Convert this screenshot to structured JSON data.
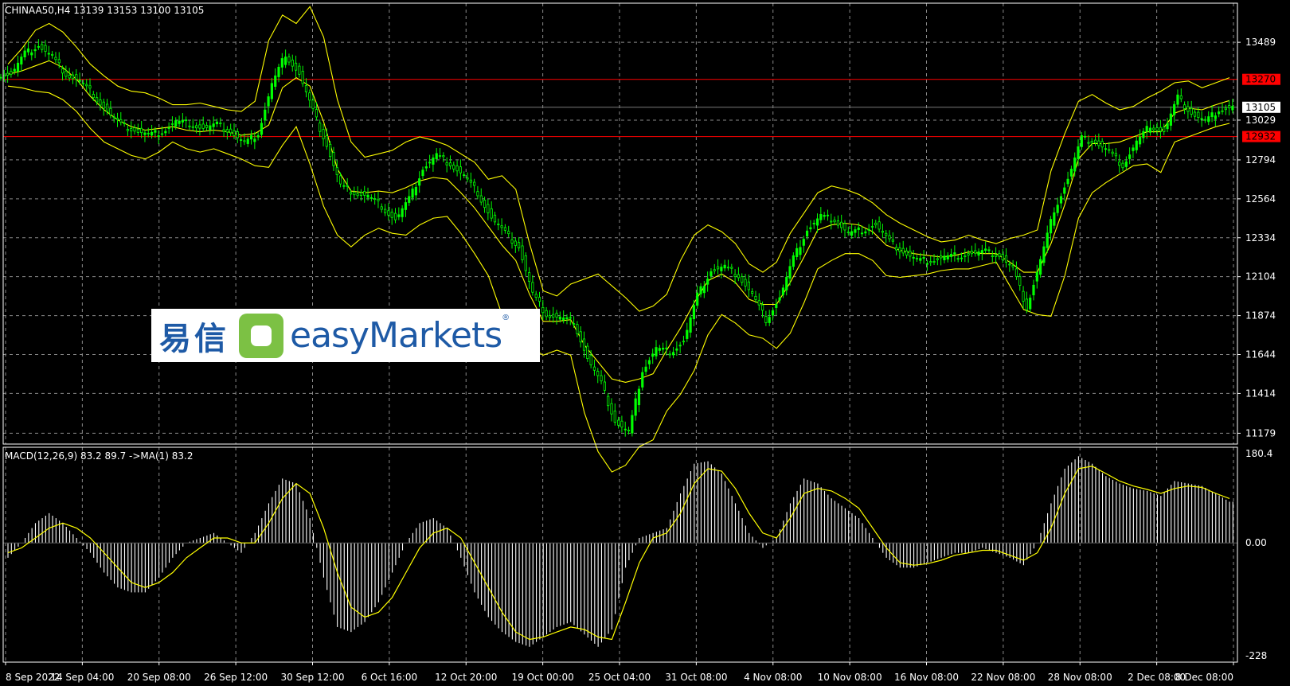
{
  "header": {
    "symbol_line": "CHINAA50,H4  13139 13153 13100 13105",
    "macd_line": "MACD(12,26,9) 83.2 89.7  ->MA(1) 83.2"
  },
  "logo": {
    "chinese": "易信",
    "english": "easyMarkets",
    "reg": "®"
  },
  "colors": {
    "background": "#000000",
    "grid": "#8a8a8a",
    "candle": "#00ff00",
    "bands": "#ffff00",
    "hline": "#ff0000",
    "text": "#ffffff",
    "macd_hist": "#ffffff",
    "macd_signal": "#ffff00"
  },
  "chart_data": [
    {
      "type": "line",
      "name": "price",
      "y_ticks": [
        13489,
        13029,
        12794,
        12564,
        12334,
        12104,
        11874,
        11644,
        11414,
        11179
      ],
      "ylim": [
        11115,
        13720
      ],
      "horizontal_levels": [
        13270,
        12932
      ],
      "current_price": 13105,
      "x_ticks": [
        "8 Sep 2022",
        "14 Sep 04:00",
        "20 Sep 08:00",
        "26 Sep 12:00",
        "30 Sep 12:00",
        "6 Oct 16:00",
        "12 Oct 20:00",
        "19 Oct 00:00",
        "25 Oct 04:00",
        "31 Oct 08:00",
        "4 Nov 08:00",
        "10 Nov 08:00",
        "16 Nov 08:00",
        "22 Nov 08:00",
        "28 Nov 08:00",
        "2 Dec 08:00",
        "8 Dec 08:00"
      ],
      "close": [
        13300,
        13420,
        13470,
        13400,
        13300,
        13260,
        13180,
        13080,
        13000,
        12970,
        12940,
        12960,
        13020,
        13010,
        12980,
        13000,
        12960,
        12890,
        12950,
        13240,
        13420,
        13300,
        13080,
        12880,
        12640,
        12600,
        12580,
        12520,
        12440,
        12560,
        12740,
        12820,
        12770,
        12700,
        12600,
        12450,
        12360,
        12280,
        12000,
        11880,
        11860,
        11840,
        11620,
        11470,
        11250,
        11180,
        11550,
        11680,
        11660,
        11720,
        11990,
        12140,
        12160,
        12110,
        12000,
        11850,
        11980,
        12210,
        12380,
        12460,
        12440,
        12360,
        12380,
        12410,
        12310,
        12250,
        12200,
        12200,
        12220,
        12230,
        12240,
        12250,
        12230,
        12150,
        11920,
        12200,
        12500,
        12680,
        12920,
        12900,
        12840,
        12760,
        12900,
        13000,
        12960,
        13160,
        13070,
        13020,
        13090,
        13105
      ],
      "upper_band": [
        13360,
        13450,
        13560,
        13600,
        13550,
        13460,
        13360,
        13290,
        13230,
        13200,
        13190,
        13160,
        13120,
        13120,
        13130,
        13110,
        13090,
        13080,
        13140,
        13500,
        13650,
        13600,
        13700,
        13520,
        13150,
        12900,
        12810,
        12830,
        12850,
        12900,
        12930,
        12910,
        12880,
        12830,
        12780,
        12680,
        12700,
        12620,
        12300,
        12020,
        11990,
        12060,
        12090,
        12120,
        12050,
        11980,
        11900,
        11930,
        12000,
        12200,
        12350,
        12410,
        12370,
        12300,
        12180,
        12130,
        12190,
        12360,
        12480,
        12600,
        12640,
        12620,
        12590,
        12540,
        12470,
        12420,
        12380,
        12340,
        12310,
        12320,
        12350,
        12320,
        12300,
        12330,
        12350,
        12380,
        12730,
        12950,
        13140,
        13180,
        13130,
        13090,
        13110,
        13160,
        13200,
        13250,
        13260,
        13220,
        13250,
        13280
      ],
      "lower_band": [
        13230,
        13220,
        13200,
        13190,
        13150,
        13080,
        12980,
        12900,
        12860,
        12820,
        12800,
        12840,
        12900,
        12860,
        12840,
        12860,
        12830,
        12800,
        12760,
        12750,
        12880,
        12990,
        12770,
        12520,
        12350,
        12280,
        12350,
        12390,
        12360,
        12350,
        12410,
        12450,
        12460,
        12360,
        12240,
        12110,
        11880,
        11790,
        11690,
        11640,
        11670,
        11640,
        11300,
        11070,
        10950,
        10990,
        11100,
        11140,
        11310,
        11410,
        11550,
        11760,
        11880,
        11830,
        11760,
        11740,
        11680,
        11770,
        11950,
        12150,
        12200,
        12240,
        12240,
        12200,
        12110,
        12100,
        12110,
        12120,
        12140,
        12150,
        12150,
        12170,
        12190,
        12050,
        11910,
        11880,
        11870,
        12110,
        12450,
        12600,
        12660,
        12710,
        12760,
        12770,
        12720,
        12900,
        12930,
        12960,
        12990,
        13010
      ],
      "middle_band": [
        13300,
        13320,
        13350,
        13380,
        13340,
        13270,
        13170,
        13090,
        13030,
        12990,
        12970,
        12980,
        12990,
        12970,
        12960,
        12970,
        12960,
        12940,
        12950,
        13000,
        13220,
        13280,
        13230,
        13020,
        12740,
        12610,
        12600,
        12610,
        12600,
        12630,
        12670,
        12690,
        12680,
        12600,
        12510,
        12400,
        12290,
        12200,
        12000,
        11840,
        11840,
        11850,
        11700,
        11600,
        11500,
        11480,
        11500,
        11530,
        11670,
        11800,
        11950,
        12080,
        12120,
        12070,
        11970,
        11940,
        11940,
        12070,
        12220,
        12380,
        12410,
        12420,
        12410,
        12370,
        12290,
        12260,
        12240,
        12230,
        12220,
        12230,
        12250,
        12240,
        12240,
        12190,
        12130,
        12130,
        12300,
        12530,
        12800,
        12890,
        12890,
        12900,
        12930,
        12960,
        12960,
        13070,
        13100,
        13090,
        13120,
        13145
      ]
    },
    {
      "type": "bar",
      "name": "MACD(12,26,9)",
      "y_ticks": [
        180.4,
        0.0,
        -228
      ],
      "ylim": [
        -228,
        180.4
      ],
      "histogram": [
        -30,
        0,
        40,
        60,
        40,
        10,
        -20,
        -60,
        -90,
        -100,
        -100,
        -70,
        -30,
        0,
        10,
        20,
        0,
        -20,
        20,
        80,
        130,
        120,
        50,
        -70,
        -170,
        -180,
        -160,
        -120,
        -60,
        0,
        40,
        50,
        30,
        -30,
        -100,
        -150,
        -180,
        -200,
        -210,
        -190,
        -170,
        -160,
        -185,
        -210,
        -175,
        -50,
        10,
        20,
        30,
        100,
        160,
        165,
        140,
        80,
        20,
        -10,
        10,
        80,
        130,
        120,
        90,
        70,
        50,
        10,
        -30,
        -50,
        -50,
        -40,
        -30,
        -20,
        -20,
        -10,
        -20,
        -30,
        -45,
        0,
        80,
        150,
        175,
        160,
        135,
        120,
        110,
        105,
        95,
        125,
        120,
        115,
        100,
        83.2
      ],
      "signal": [
        -20,
        -10,
        10,
        30,
        40,
        30,
        10,
        -20,
        -50,
        -80,
        -90,
        -80,
        -60,
        -30,
        -10,
        10,
        10,
        0,
        0,
        40,
        90,
        120,
        100,
        30,
        -60,
        -130,
        -150,
        -140,
        -110,
        -60,
        -10,
        20,
        30,
        10,
        -40,
        -90,
        -140,
        -180,
        -195,
        -190,
        -180,
        -170,
        -175,
        -190,
        -195,
        -120,
        -40,
        10,
        20,
        60,
        120,
        150,
        145,
        110,
        60,
        20,
        10,
        50,
        100,
        110,
        105,
        90,
        70,
        30,
        -10,
        -40,
        -45,
        -42,
        -35,
        -25,
        -20,
        -15,
        -15,
        -25,
        -35,
        -20,
        30,
        100,
        150,
        155,
        140,
        125,
        115,
        108,
        100,
        110,
        115,
        112,
        100,
        89.7
      ]
    }
  ]
}
